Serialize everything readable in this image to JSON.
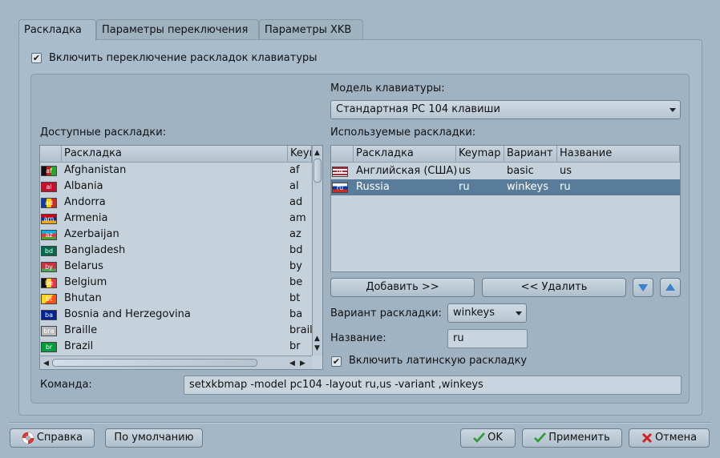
{
  "tabs": [
    "Раскладка",
    "Параметры переключения",
    "Параметры XKB"
  ],
  "enable_switching": {
    "label": "Включить переключение раскладок клавиатуры",
    "checked": true
  },
  "keyboard_model": {
    "label": "Модель клавиатуры:",
    "value": "Стандартная PC 104 клавиши"
  },
  "available": {
    "label": "Доступные раскладки:",
    "headers": [
      "Раскладка",
      "Keymap"
    ],
    "rows": [
      {
        "flag": "af",
        "name": "Afghanistan",
        "keymap": "af"
      },
      {
        "flag": "al",
        "name": "Albania",
        "keymap": "al"
      },
      {
        "flag": "ad",
        "name": "Andorra",
        "keymap": "ad"
      },
      {
        "flag": "am",
        "name": "Armenia",
        "keymap": "am"
      },
      {
        "flag": "az",
        "name": "Azerbaijan",
        "keymap": "az"
      },
      {
        "flag": "bd",
        "name": "Bangladesh",
        "keymap": "bd"
      },
      {
        "flag": "by",
        "name": "Belarus",
        "keymap": "by"
      },
      {
        "flag": "be",
        "name": "Belgium",
        "keymap": "be"
      },
      {
        "flag": "bt",
        "name": "Bhutan",
        "keymap": "bt"
      },
      {
        "flag": "ba",
        "name": "Bosnia and Herzegovina",
        "keymap": "ba"
      },
      {
        "flag": "bra",
        "name": "Braille",
        "keymap": "braille"
      },
      {
        "flag": "br",
        "name": "Brazil",
        "keymap": "br"
      }
    ]
  },
  "used": {
    "label": "Используемые раскладки:",
    "headers": [
      "Раскладка",
      "Keymap",
      "Вариант",
      "Название"
    ],
    "rows": [
      {
        "flag": "us",
        "layout": "Английская (США)",
        "keymap": "us",
        "variant": "basic",
        "name": "us",
        "selected": false
      },
      {
        "flag": "ru",
        "layout": "Russia",
        "keymap": "ru",
        "variant": "winkeys",
        "name": "ru",
        "selected": true
      }
    ]
  },
  "add_button": "Добавить >>",
  "remove_button": "<< Удалить",
  "variant": {
    "label": "Вариант раскладки:",
    "value": "winkeys"
  },
  "name_field": {
    "label": "Название:",
    "value": "ru"
  },
  "latin": {
    "label": "Включить латинскую раскладку",
    "checked": true
  },
  "command": {
    "label": "Команда:",
    "value": "setxkbmap -model pc104 -layout ru,us -variant ,winkeys"
  },
  "footer": {
    "help": "Справка",
    "defaults": "По умолчанию",
    "ok": "OK",
    "apply": "Применить",
    "cancel": "Отмена"
  },
  "colors": {
    "window_bg": "#a3b7c6",
    "selection": "#587c99",
    "ok_check": "#2f9a2f",
    "cancel_x": "#d42020",
    "move_arrows": "#3b7fd0"
  },
  "icons": {
    "help": "lifebuoy-icon",
    "ok": "checkmark-icon",
    "apply": "checkmark-icon",
    "cancel": "red-x-icon",
    "move_down": "arrow-down-icon",
    "move_up": "arrow-up-icon"
  }
}
